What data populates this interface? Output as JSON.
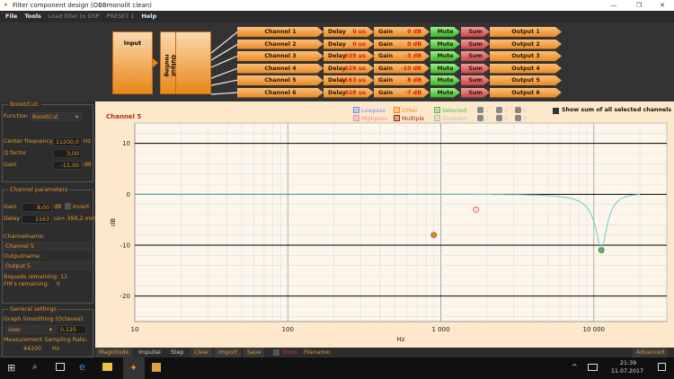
{
  "window": {
    "title": "Filter component design (OBBmonolit clean)",
    "controls": [
      "—",
      "❐",
      "✕"
    ]
  },
  "menu": [
    {
      "label": "File",
      "enabled": true
    },
    {
      "label": "Tools",
      "enabled": true
    },
    {
      "label": "Load filter to DSP",
      "enabled": false
    },
    {
      "label": "PRESET 1",
      "enabled": false
    },
    {
      "label": "Help",
      "enabled": true
    }
  ],
  "diagram": {
    "input_label": "Input",
    "routing_label": "Output routing",
    "channels": [
      {
        "name": "Channel 1",
        "delay_label": "Delay",
        "delay": "0 us",
        "gain_label": "Gain",
        "gain": "0 dB",
        "mute": "Mute",
        "sum": "Sum",
        "output": "Output 1"
      },
      {
        "name": "Channel 2",
        "delay_label": "Delay",
        "delay": "0 us",
        "gain_label": "Gain",
        "gain": "0 dB",
        "mute": "Mute",
        "sum": "Sum",
        "output": "Output 2"
      },
      {
        "name": "Channel 3",
        "delay_label": "Delay",
        "delay": "939 us",
        "gain_label": "Gain",
        "gain": "-3 dB",
        "mute": "Mute",
        "sum": "Sum",
        "output": "Output 3"
      },
      {
        "name": "Channel 4",
        "delay_label": "Delay",
        "delay": "629 us",
        "gain_label": "Gain",
        "gain": "-10 dB",
        "mute": "Mute",
        "sum": "Sum",
        "output": "Output 4"
      },
      {
        "name": "Channel 5",
        "delay_label": "Delay",
        "delay": "1163 us",
        "gain_label": "Gain",
        "gain": "8 dB",
        "mute": "Mute",
        "sum": "Sum",
        "output": "Output 5",
        "selected": true
      },
      {
        "name": "Channel 6",
        "delay_label": "Delay",
        "delay": "928 us",
        "gain_label": "Gain",
        "gain": "-7 dB",
        "mute": "Mute",
        "sum": "Sum",
        "output": "Output 6"
      }
    ]
  },
  "boostcut": {
    "title": "Boost/Cut:",
    "function_label": "Function",
    "function_value": "BoostCut",
    "cf_label": "Center frequency",
    "cf_value": "11200,0",
    "cf_unit": "Hz",
    "q_label": "Q factor",
    "q_value": "3,00",
    "gain_label": "Gain",
    "gain_value": "-11,00",
    "gain_unit": "dB"
  },
  "channel_params": {
    "title": "Channel parameters",
    "gain_label": "Gain",
    "gain_value": "8,00",
    "gain_unit": "dB",
    "invert_label": "Invert",
    "delay_label": "Delay",
    "delay_value": "1163",
    "delay_unit": "us= 399,2 mm",
    "channelname_label": "Channelname:",
    "channelname_value": "Channel 5",
    "outputname_label": "Outputname:",
    "outputname_value": "Output 5",
    "biquads": "Biquads remaining: 11",
    "firs": "FIR's remaining:    0"
  },
  "general": {
    "title": "General settings",
    "smoothing_label": "Graph Smoothing (Octaves):",
    "smoothing_mode": "User",
    "smoothing_value": "0,125",
    "rate_label": "Measurement Sampling Rate:",
    "rate_value": "44100",
    "rate_unit": "Hz"
  },
  "chart_header": {
    "title": "Channel 5",
    "legend": [
      {
        "label": "Lowpass",
        "color": "#6f8ff0"
      },
      {
        "label": "Highpass",
        "color": "#f08a9a"
      },
      {
        "label": "Other",
        "color": "#f08a10"
      },
      {
        "label": "Multiple",
        "color": "#a02010"
      },
      {
        "label": "Selected",
        "color": "#50c050"
      },
      {
        "label": "Disabled",
        "color": "#bbbbbb"
      }
    ],
    "channel_toggles": [
      "1",
      "2",
      "3",
      "4",
      "5",
      "6"
    ],
    "sum_label": "Show sum of all selected channels"
  },
  "chart_data": {
    "type": "line",
    "xlabel": "Hz",
    "ylabel": "dB",
    "x_scale": "log",
    "xlim": [
      10,
      30000
    ],
    "ylim": [
      -25,
      14
    ],
    "x_ticks": [
      "10",
      "100",
      "1 000",
      "10 000"
    ],
    "y_ticks": [
      "10",
      "0",
      "-10",
      "-20"
    ],
    "grid": true,
    "curve": {
      "filter": "peaking",
      "fc": 11200,
      "q": 3,
      "gain_db": -11,
      "fs": 44100,
      "color": "#6ec9c9"
    },
    "points": [
      {
        "x": 900,
        "y": -8,
        "color": "#f08a10",
        "type": "Other"
      },
      {
        "x": 1700,
        "y": -3,
        "color": "#f08a9a",
        "type": "Highpass"
      },
      {
        "x": 11200,
        "y": -11,
        "color": "#50c050",
        "type": "Selected"
      }
    ]
  },
  "bottom": {
    "tabs": [
      "Magnitude",
      "Impulse",
      "Step"
    ],
    "buttons": [
      "Clear",
      "Import",
      "Save"
    ],
    "show_label": "Show",
    "filename_label": "Filename:",
    "advanced": "Advanced"
  },
  "taskbar": {
    "time": "21:39",
    "date": "11.07.2017"
  }
}
